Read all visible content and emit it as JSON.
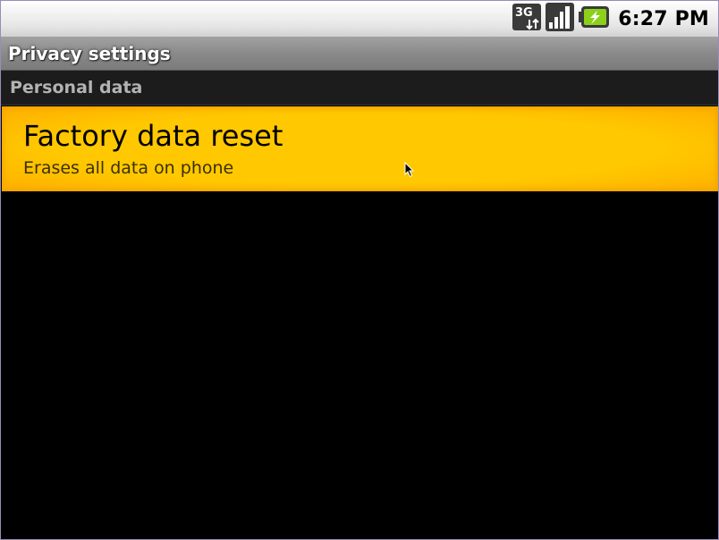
{
  "status_bar": {
    "network_icon": "3g-data-icon",
    "network_label": "3G",
    "signal_icon": "signal-strength-icon",
    "battery_icon": "battery-charging-icon",
    "time": "6:27 PM"
  },
  "header": {
    "title": "Privacy settings"
  },
  "category": {
    "label": "Personal data"
  },
  "preferences": [
    {
      "title": "Factory data reset",
      "summary": "Erases all data on phone"
    }
  ],
  "colors": {
    "highlight": "#ffc200",
    "background": "#000000",
    "category_bg": "#1c1c1c",
    "category_text": "#b3b3b3"
  }
}
